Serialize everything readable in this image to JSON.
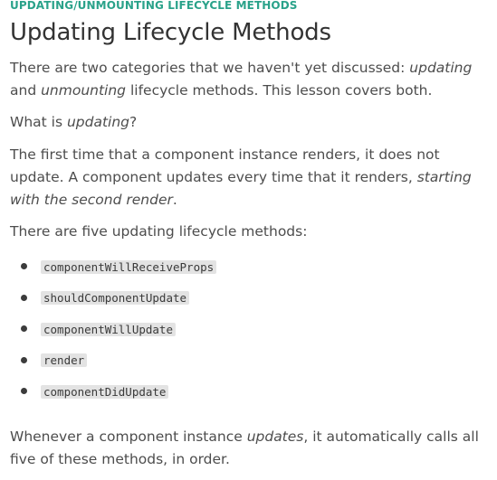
{
  "lesson": {
    "eyebrow": "UPDATING/UNMOUNTING LIFECYCLE METHODS",
    "title": "Updating Lifecycle Methods",
    "intro": {
      "before": "There are two categories that we haven't yet discussed: ",
      "em1": "updating",
      "middle": " and ",
      "em2": "unmounting",
      "after": " lifecycle methods. This lesson covers both."
    },
    "question": {
      "before": "What is ",
      "em": "updating",
      "after": "?"
    },
    "explanation": {
      "before": "The first time that a component instance renders, it does not update. A component updates every time that it renders, ",
      "em": "starting with the second render",
      "after": "."
    },
    "list_intro": "There are five updating lifecycle methods:",
    "methods": [
      "componentWillReceiveProps",
      "shouldComponentUpdate",
      "componentWillUpdate",
      "render",
      "componentDidUpdate"
    ],
    "closing": {
      "before": "Whenever a component instance ",
      "em": "updates",
      "after": ", it automatically calls all five of these methods, in order."
    }
  },
  "colors": {
    "eyebrow": "#2aa28a",
    "title": "#333333",
    "body_text": "#4d4d4d",
    "code_background": "#e3e3e3",
    "bullet": "#3c3c3c"
  }
}
